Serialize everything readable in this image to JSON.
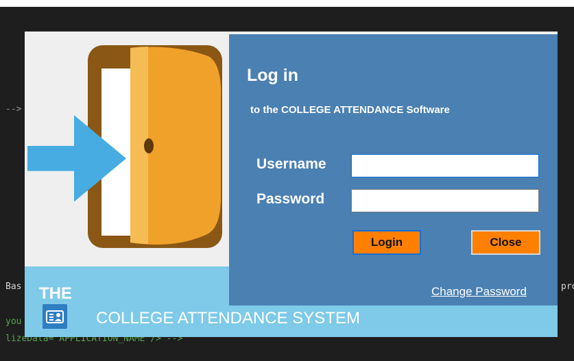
{
  "background_code": {
    "line1": "-->",
    "line2": "Bas",
    "line3": "pro",
    "line4": "you",
    "line5": "lizeData= APPLICATION_NAME /> -->"
  },
  "dialog": {
    "title": "Log in",
    "subtitle": "to the COLLEGE ATTENDANCE  Software",
    "username_label": "Username",
    "username_value": "",
    "password_label": "Password",
    "password_value": "",
    "login_button": "Login",
    "close_button": "Close",
    "change_password_link": "Change Password"
  },
  "footer": {
    "the": "THE",
    "system_name": "COLLEGE ATTENDANCE SYSTEM",
    "icon": "id-card-icon"
  },
  "art": {
    "icon": "door-enter-icon"
  },
  "colors": {
    "panel": "#4a80b2",
    "footer": "#7ecae8",
    "button": "#ff7f00",
    "door": "#f0a12a",
    "arrow": "#46ace2"
  }
}
